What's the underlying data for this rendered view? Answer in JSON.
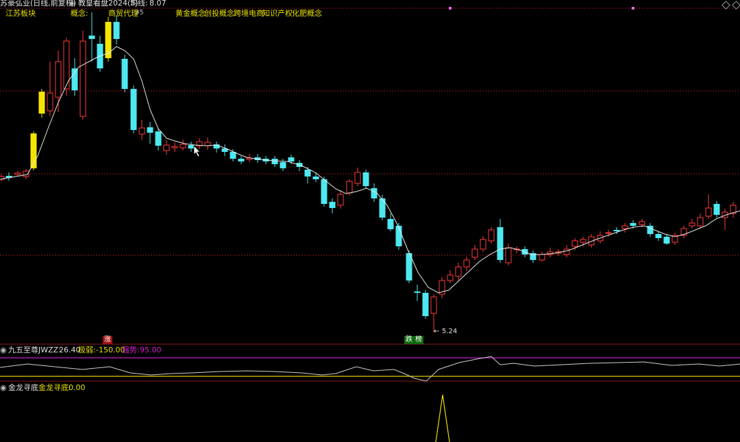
{
  "header": {
    "stock_name": "苏豪弘业(日线,前复权)",
    "indicator": "教皇看盘2024(5)",
    "ma_label": "均线:",
    "ma_value": "8.07",
    "tags": {
      "region": "江苏板块",
      "concept_label": "概念:",
      "concept_value": "商贸代理",
      "hidden_num": "95",
      "concepts": [
        "黄金概念",
        "创投概念",
        "跨境电商",
        "知识产权",
        "化肥概念"
      ]
    }
  },
  "chart": {
    "low_price_label": "5.24",
    "signal_up": "涨",
    "signal_down_1": "跌",
    "signal_down_2": "榜"
  },
  "panel2": {
    "name": "九五至尊",
    "jwzz_label": "JWZZ:",
    "jwzz_value": "26.40",
    "limit_label": "极弱:",
    "limit_value": "-150.00",
    "strong_label": "强势:",
    "strong_value": "95.00"
  },
  "panel3": {
    "name": "金龙寻底",
    "value_label": "金龙寻底:",
    "value": "0.00"
  },
  "colors": {
    "up": "#ff3b3b",
    "down": "#4de8f0",
    "yellow": "#f5e600",
    "grid": "#8b1a1a",
    "ma": "#e8e8e8"
  }
}
